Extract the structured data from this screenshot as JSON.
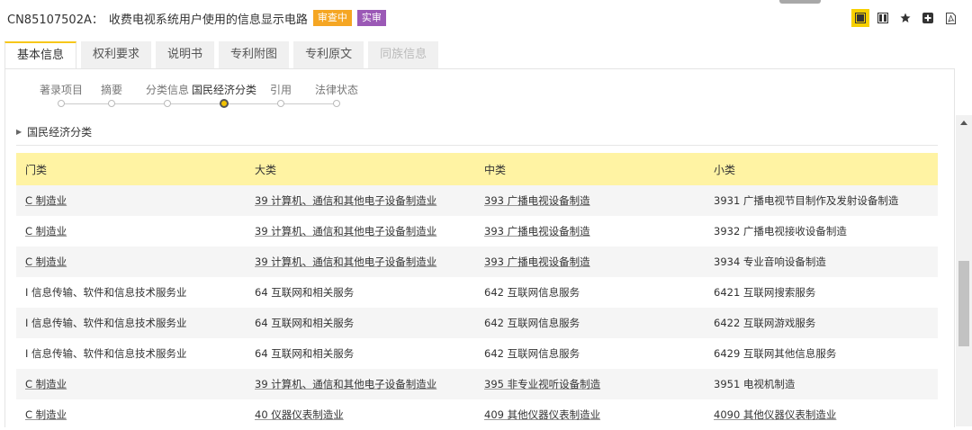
{
  "header": {
    "patent_id": "CN85107502A：",
    "title": "收费电视系统用户使用的信息显示电路",
    "badge_review": "审查中",
    "badge_exam": "实审"
  },
  "tools": [
    {
      "name": "single-view-icon",
      "active": true
    },
    {
      "name": "split-view-icon",
      "active": false
    },
    {
      "name": "star-icon",
      "active": false
    },
    {
      "name": "add-icon",
      "active": false
    },
    {
      "name": "pdf-icon",
      "active": false
    }
  ],
  "tabs": [
    {
      "label": "基本信息"
    },
    {
      "label": "权利要求"
    },
    {
      "label": "说明书"
    },
    {
      "label": "专利附图"
    },
    {
      "label": "专利原文"
    },
    {
      "label": "同族信息"
    }
  ],
  "steps": [
    {
      "label": "著录项目"
    },
    {
      "label": "摘要"
    },
    {
      "label": "分类信息"
    },
    {
      "label": "国民经济分类"
    },
    {
      "label": "引用"
    },
    {
      "label": "法律状态"
    }
  ],
  "section": {
    "title": "国民经济分类"
  },
  "table": {
    "columns": [
      "门类",
      "大类",
      "中类",
      "小类"
    ],
    "rows": [
      [
        "C 制造业",
        "39 计算机、通信和其他电子设备制造业",
        "393 广播电视设备制造",
        "3931 广播电视节目制作及发射设备制造"
      ],
      [
        "C 制造业",
        "39 计算机、通信和其他电子设备制造业",
        "393 广播电视设备制造",
        "3932 广播电视接收设备制造"
      ],
      [
        "C 制造业",
        "39 计算机、通信和其他电子设备制造业",
        "393 广播电视设备制造",
        "3934 专业音响设备制造"
      ],
      [
        "I 信息传输、软件和信息技术服务业",
        "64 互联网和相关服务",
        "642 互联网信息服务",
        "6421 互联网搜索服务"
      ],
      [
        "I 信息传输、软件和信息技术服务业",
        "64 互联网和相关服务",
        "642 互联网信息服务",
        "6422 互联网游戏服务"
      ],
      [
        "I 信息传输、软件和信息技术服务业",
        "64 互联网和相关服务",
        "642 互联网信息服务",
        "6429 互联网其他信息服务"
      ],
      [
        "C 制造业",
        "39 计算机、通信和其他电子设备制造业",
        "395 非专业视听设备制造",
        "3951 电视机制造"
      ],
      [
        "C 制造业",
        "40 仪器仪表制造业",
        "409 其他仪器仪表制造业",
        "4090 其他仪器仪表制造业"
      ]
    ]
  },
  "colors": {
    "accent": "#f7d000",
    "header_row": "#fff3a3",
    "badge_review": "#f5a623",
    "badge_exam": "#9b59b6"
  }
}
